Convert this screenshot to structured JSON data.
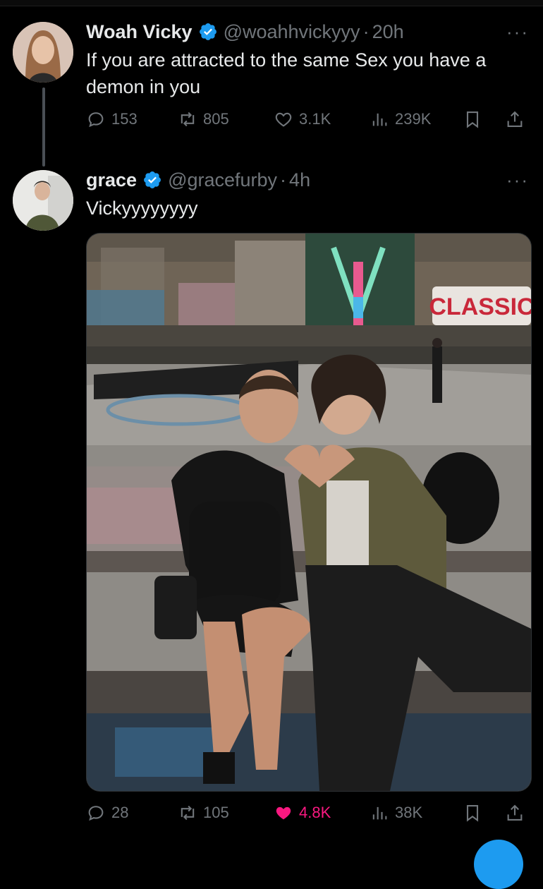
{
  "tweet1": {
    "name": "Woah Vicky",
    "handle": "@woahhvickyyy",
    "dot": "·",
    "time": "20h",
    "text": "If you are attracted to the same Sex you have a demon in you",
    "replies": "153",
    "retweets": "805",
    "likes": "3.1K",
    "views": "239K"
  },
  "tweet2": {
    "name": "grace",
    "handle": "@gracefurby",
    "dot": "·",
    "time": "4h",
    "text": "Vickyyyyyyyy",
    "replies": "28",
    "retweets": "105",
    "likes": "4.8K",
    "views": "38K",
    "photo_text": "CLASSIC"
  },
  "more_glyph": "···",
  "colors": {
    "background": "#000000",
    "text": "#e7e9ea",
    "muted": "#71767b",
    "verified": "#1d9bf0",
    "like_active": "#f91880"
  },
  "icons": [
    "verified-badge-icon",
    "more-icon",
    "reply-icon",
    "retweet-icon",
    "like-icon",
    "views-icon",
    "bookmark-icon",
    "share-icon"
  ]
}
